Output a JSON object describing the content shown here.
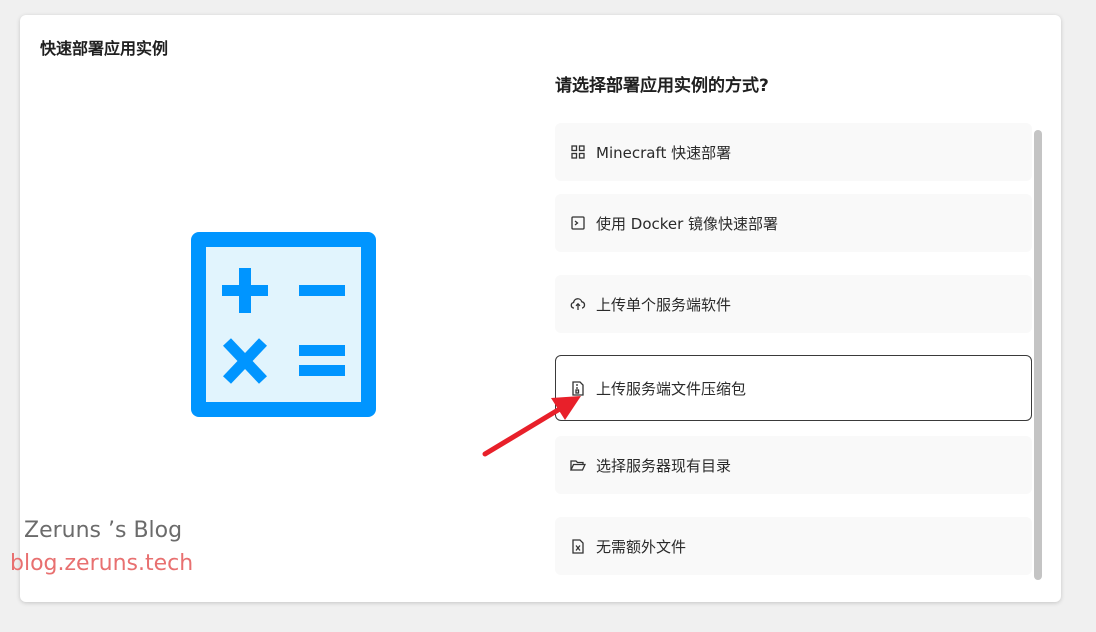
{
  "card": {
    "title": "快速部署应用实例",
    "question": "请选择部署应用实例的方式?"
  },
  "options": [
    {
      "label": "Minecraft 快速部署",
      "icon": "grid-icon"
    },
    {
      "label": "使用 Docker 镜像快速部署",
      "icon": "terminal-icon"
    },
    {
      "label": "上传单个服务端软件",
      "icon": "cloud-upload-icon"
    },
    {
      "label": "上传服务端文件压缩包",
      "icon": "file-zip-icon",
      "selected": true
    },
    {
      "label": "选择服务器现有目录",
      "icon": "folder-open-icon"
    },
    {
      "label": "无需额外文件",
      "icon": "file-x-icon"
    }
  ],
  "watermark": {
    "name": "Zeruns ’s Blog",
    "url": "blog.zeruns.tech"
  },
  "colors": {
    "illustration_blue": "#0095ff",
    "illustration_fill": "#e1f4fd",
    "arrow_red": "#e8202a",
    "selected_border": "#3a3a3a"
  }
}
